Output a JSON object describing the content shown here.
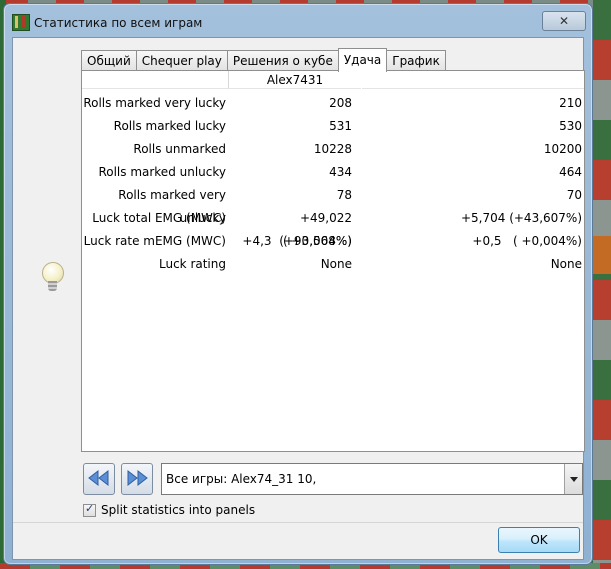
{
  "window": {
    "title": "Статистика по всем играм",
    "close_glyph": "✕"
  },
  "tabs": [
    {
      "label": "Общий"
    },
    {
      "label": "Chequer play"
    },
    {
      "label": "Решения о кубе"
    },
    {
      "label": "Удача",
      "active": true
    },
    {
      "label": "График"
    }
  ],
  "table": {
    "headers": [
      "",
      "Alex7431",
      ""
    ],
    "rows": [
      {
        "label": "Rolls marked very lucky",
        "player1": "208",
        "player2": "210"
      },
      {
        "label": "Rolls marked lucky",
        "player1": "531",
        "player2": "530"
      },
      {
        "label": "Rolls unmarked",
        "player1": "10228",
        "player2": "10200"
      },
      {
        "label": "Rolls marked unlucky",
        "player1": "434",
        "player2": "464"
      },
      {
        "label": "Rolls marked very unlucky",
        "player1": "78",
        "player2": "70"
      },
      {
        "label": "Luck total EMG (MWC)",
        "player1": "+49,022 (+93,564%)",
        "player2": "+5,704 (+43,607%)"
      },
      {
        "label": "Luck rate mEMG (MWC)",
        "player1": "+4,3   ( +0,008%)",
        "player2": "+0,5   ( +0,004%)"
      },
      {
        "label": "Luck rating",
        "player1": "None",
        "player2": "None"
      }
    ]
  },
  "game_selector": {
    "value": "Все игры: Alex74_31 10,"
  },
  "split_statistics": {
    "label": "Split statistics into panels",
    "checked": true
  },
  "buttons": {
    "ok": "OK"
  },
  "icons": {
    "prev": "rewind-icon",
    "next": "fast-forward-icon",
    "bulb": "lightbulb-icon"
  }
}
